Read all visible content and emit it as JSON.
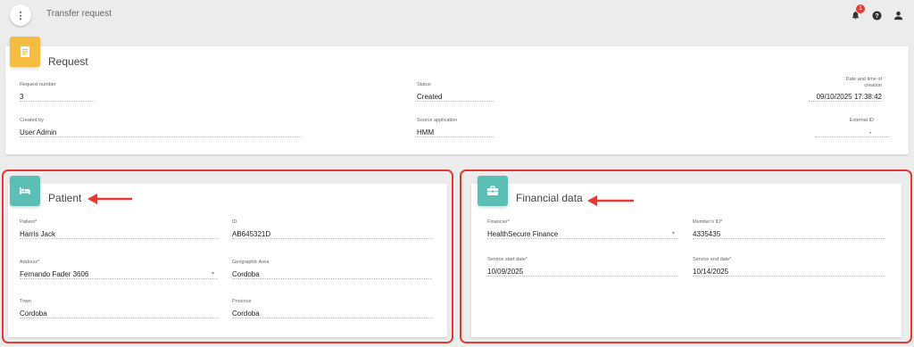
{
  "header": {
    "title": "Transfer request",
    "notification_count": "1",
    "menu_icon": "more-vertical-icon",
    "icons": [
      "bell-icon",
      "help-icon",
      "user-icon"
    ]
  },
  "request": {
    "title": "Request",
    "icon": "document-icon",
    "accent_color": "#f5bc42",
    "fields": {
      "request_number": {
        "label": "Request number",
        "value": "3"
      },
      "status": {
        "label": "Status",
        "value": "Created"
      },
      "creation_date": {
        "label": "Date and time of creation",
        "value": "09/10/2025 17:38:42"
      },
      "created_by": {
        "label": "Created by",
        "value": "User Admin"
      },
      "source_application": {
        "label": "Source application",
        "value": "HMM"
      },
      "external_id": {
        "label": "External ID",
        "value": "-"
      }
    }
  },
  "patient": {
    "title": "Patient",
    "icon": "bed-icon",
    "accent_color": "#5bbfb5",
    "fields": {
      "patient": {
        "label": "Patient*",
        "value": "Harris Jack"
      },
      "id": {
        "label": "ID",
        "value": "AB645321D"
      },
      "address": {
        "label": "Address*",
        "value": "Fernando Fader 3606"
      },
      "geographic_area": {
        "label": "Geographic Area",
        "value": "Cordoba"
      },
      "town": {
        "label": "Town",
        "value": "Cordoba"
      },
      "province": {
        "label": "Province",
        "value": "Cordoba"
      }
    }
  },
  "financial": {
    "title": "Financial data",
    "icon": "briefcase-icon",
    "accent_color": "#5bbfb5",
    "fields": {
      "financier": {
        "label": "Financier*",
        "value": "HealthSecure Finance"
      },
      "members_id": {
        "label": "Member's ID*",
        "value": "4335435"
      },
      "service_start_date": {
        "label": "Service start date*",
        "value": "10/09/2025"
      },
      "service_end_date": {
        "label": "Service end date*",
        "value": "10/14/2025"
      }
    }
  },
  "annotations": {
    "highlight_color": "#e53935"
  }
}
